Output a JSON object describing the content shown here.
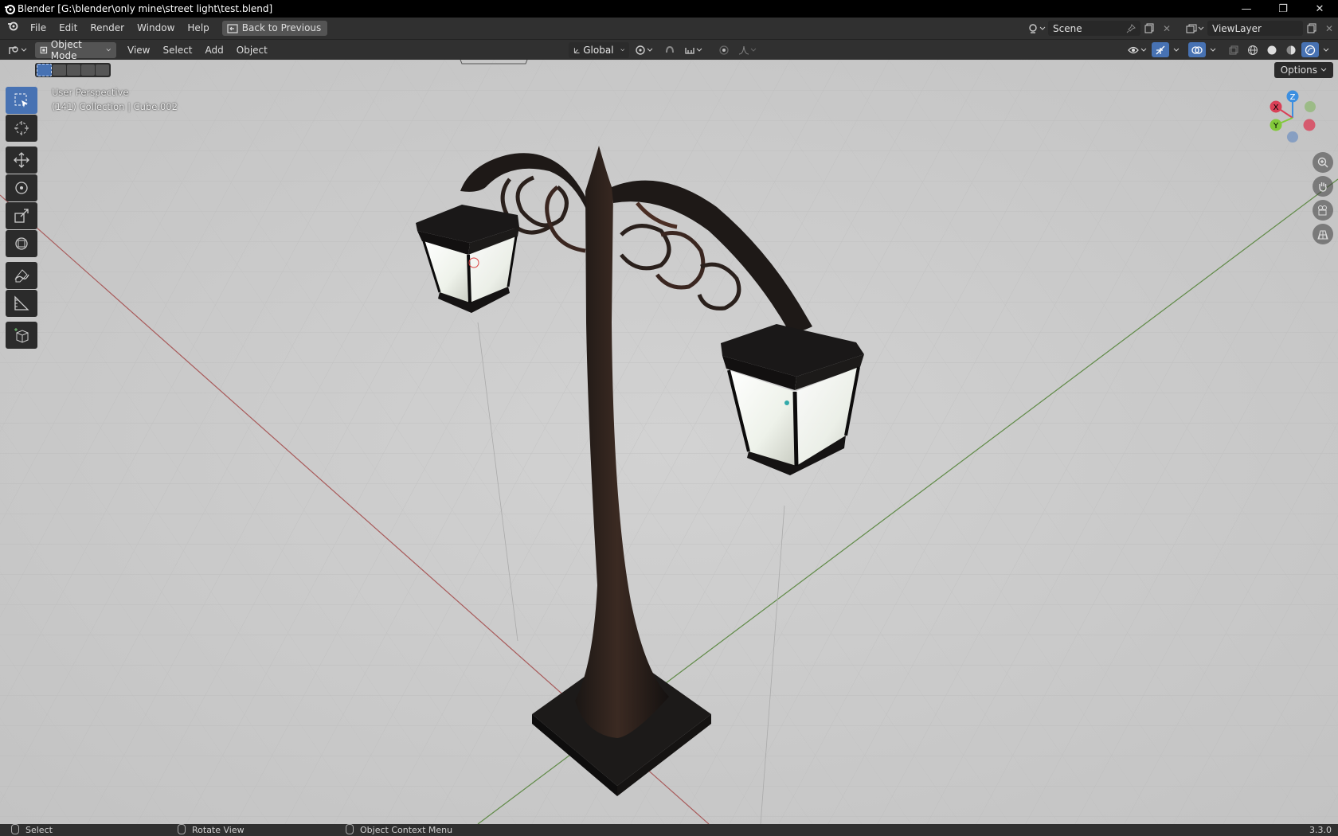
{
  "window": {
    "title": "Blender [G:\\blender\\only mine\\street light\\test.blend]",
    "controls": [
      "—",
      "❐",
      "✕"
    ]
  },
  "topbar": {
    "menus": [
      "File",
      "Edit",
      "Render",
      "Window",
      "Help"
    ],
    "back_button": "Back to Previous",
    "scene": "Scene",
    "view_layer": "ViewLayer"
  },
  "viewport_header": {
    "mode": "Object Mode",
    "menus": [
      "View",
      "Select",
      "Add",
      "Object"
    ],
    "orientation": "Global",
    "options": "Options"
  },
  "viewport": {
    "perspective": "User Perspective",
    "collection_info": "(141) Collection | Cube.002",
    "gizmo_axes": [
      "Z",
      "X",
      "Y"
    ]
  },
  "tools": [
    {
      "name": "select-box-tool",
      "icon": "select-box-icon",
      "active": true
    },
    {
      "name": "cursor-tool",
      "icon": "cursor-icon",
      "active": false
    },
    {
      "name": "move-tool",
      "icon": "move-icon",
      "active": false
    },
    {
      "name": "rotate-tool",
      "icon": "rotate-icon",
      "active": false
    },
    {
      "name": "scale-tool",
      "icon": "scale-icon",
      "active": false
    },
    {
      "name": "transform-tool",
      "icon": "transform-icon",
      "active": false
    },
    {
      "name": "annotate-tool",
      "icon": "annotate-icon",
      "active": false
    },
    {
      "name": "measure-tool",
      "icon": "measure-icon",
      "active": false
    },
    {
      "name": "add-cube-tool",
      "icon": "add-cube-icon",
      "active": false
    }
  ],
  "statusbar": {
    "select": "Select",
    "rotate_view": "Rotate View",
    "context_menu": "Object Context Menu",
    "version": "3.3.0"
  },
  "colors": {
    "accent": "#4772b3",
    "x_axis": "#d94057",
    "y_axis": "#82c93a",
    "z_axis": "#3c8fe0"
  }
}
